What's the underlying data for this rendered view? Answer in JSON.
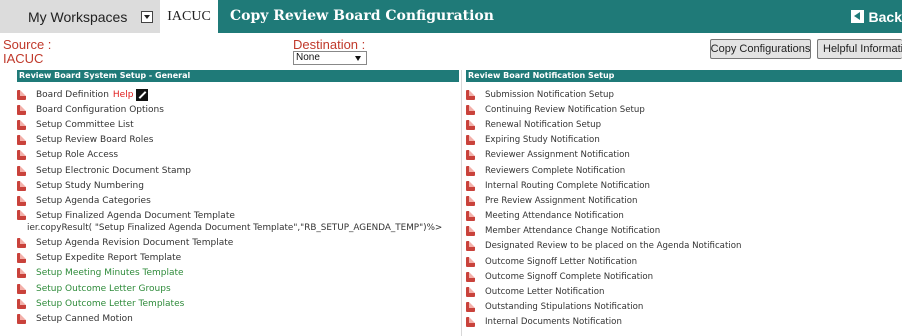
{
  "header": {
    "tabs": [
      {
        "label": "My Workspaces"
      },
      {
        "label": "IACUC"
      }
    ],
    "title": "Copy Review Board Configuration",
    "back_label": "Back"
  },
  "source": {
    "label": "Source :",
    "value": "IACUC"
  },
  "destination": {
    "label": "Destination :",
    "selected": "None"
  },
  "buttons": {
    "copy": "Copy Configurations",
    "help": "Helpful Information"
  },
  "left_panel": {
    "title": "Review Board System Setup - General",
    "help_label": "Help",
    "items": [
      {
        "label": "Board Definition"
      },
      {
        "label": "Board Configuration Options"
      },
      {
        "label": "Setup Committee List"
      },
      {
        "label": "Setup Review Board Roles"
      },
      {
        "label": "Setup Role Access"
      },
      {
        "label": "Setup Electronic Document Stamp"
      },
      {
        "label": "Setup Study Numbering"
      },
      {
        "label": "Setup Agenda Categories"
      },
      {
        "label": "Setup Finalized Agenda Document Template",
        "extra": "ier.copyResult( \"Setup Finalized Agenda Document Template\",\"RB_SETUP_AGENDA_TEMP\")%>"
      },
      {
        "label": "Setup Agenda Revision Document Template"
      },
      {
        "label": "Setup Expedite Report Template"
      },
      {
        "label": "Setup Meeting Minutes Template"
      },
      {
        "label": "Setup Outcome Letter Groups"
      },
      {
        "label": "Setup Outcome Letter Templates"
      },
      {
        "label": "Setup Canned Motion"
      }
    ]
  },
  "right_panel": {
    "title": "Review Board  Notification Setup",
    "items": [
      {
        "label": "Submission Notification Setup"
      },
      {
        "label": "Continuing Review Notification Setup"
      },
      {
        "label": "Renewal Notification Setup"
      },
      {
        "label": "Expiring Study Notification"
      },
      {
        "label": "Reviewer Assignment Notification"
      },
      {
        "label": "Reviewers Complete Notification"
      },
      {
        "label": "Internal Routing Complete Notification"
      },
      {
        "label": "Pre Review Assignment Notification"
      },
      {
        "label": "Meeting Attendance Notification"
      },
      {
        "label": "Member Attendance Change Notification"
      },
      {
        "label": "Designated Review to be placed on the Agenda Notification"
      },
      {
        "label": "Outcome Signoff Letter Notification"
      },
      {
        "label": "Outcome Signoff Complete Notification"
      },
      {
        "label": "Outcome Letter Notification"
      },
      {
        "label": "Outstanding Stipulations Notification"
      },
      {
        "label": "Internal Documents Notification"
      }
    ]
  },
  "colors": {
    "header_bg": "#1f7a78",
    "red_text": "#c0392b",
    "green_link": "#2e8b3a",
    "doc_icon": "#c9423b"
  }
}
